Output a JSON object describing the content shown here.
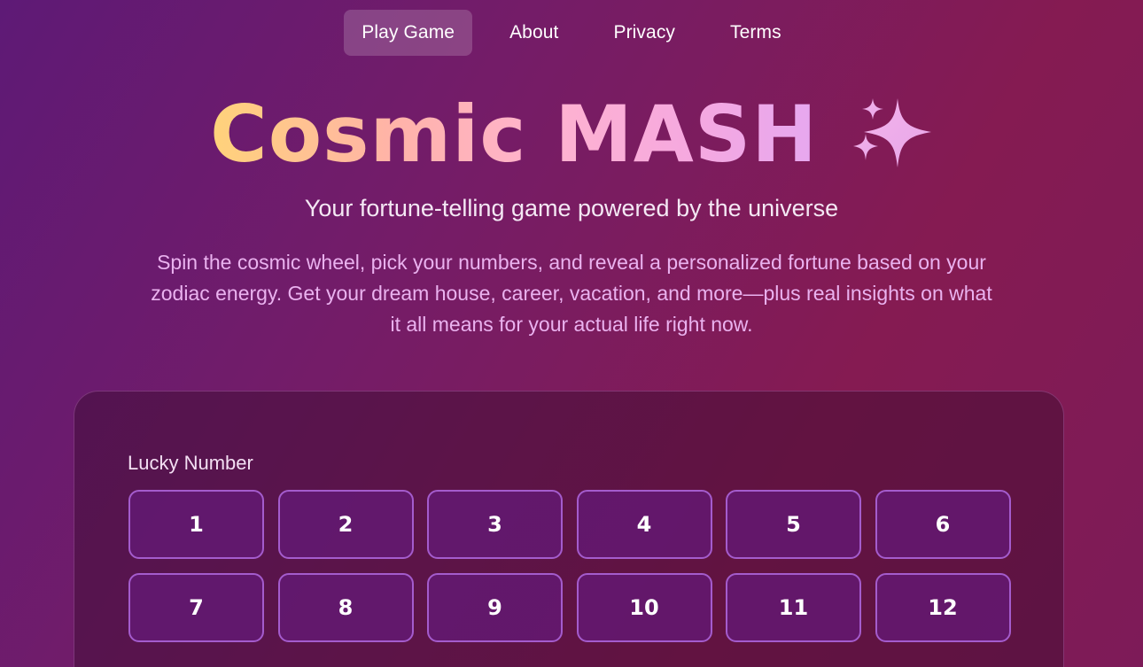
{
  "nav": {
    "items": [
      {
        "label": "Play Game",
        "active": true
      },
      {
        "label": "About",
        "active": false
      },
      {
        "label": "Privacy",
        "active": false
      },
      {
        "label": "Terms",
        "active": false
      }
    ]
  },
  "hero": {
    "title": "Cosmic MASH",
    "title_icon": "sparkles-icon",
    "subtitle": "Your fortune-telling game powered by the universe",
    "description": "Spin the cosmic wheel, pick your numbers, and reveal a personalized fortune based on your zodiac energy. Get your dream house, career, vacation, and more—plus real insights on what it all means for your actual life right now."
  },
  "lucky_number": {
    "label": "Lucky Number",
    "options": [
      "1",
      "2",
      "3",
      "4",
      "5",
      "6",
      "7",
      "8",
      "9",
      "10",
      "11",
      "12"
    ]
  },
  "colors": {
    "background_start": "#5e1a76",
    "background_end": "#851b52",
    "title_gradient_start": "#ffd37a",
    "title_gradient_end": "#e6a8f0",
    "button_border": "#a45ccd",
    "description_text": "#eab2ef"
  }
}
